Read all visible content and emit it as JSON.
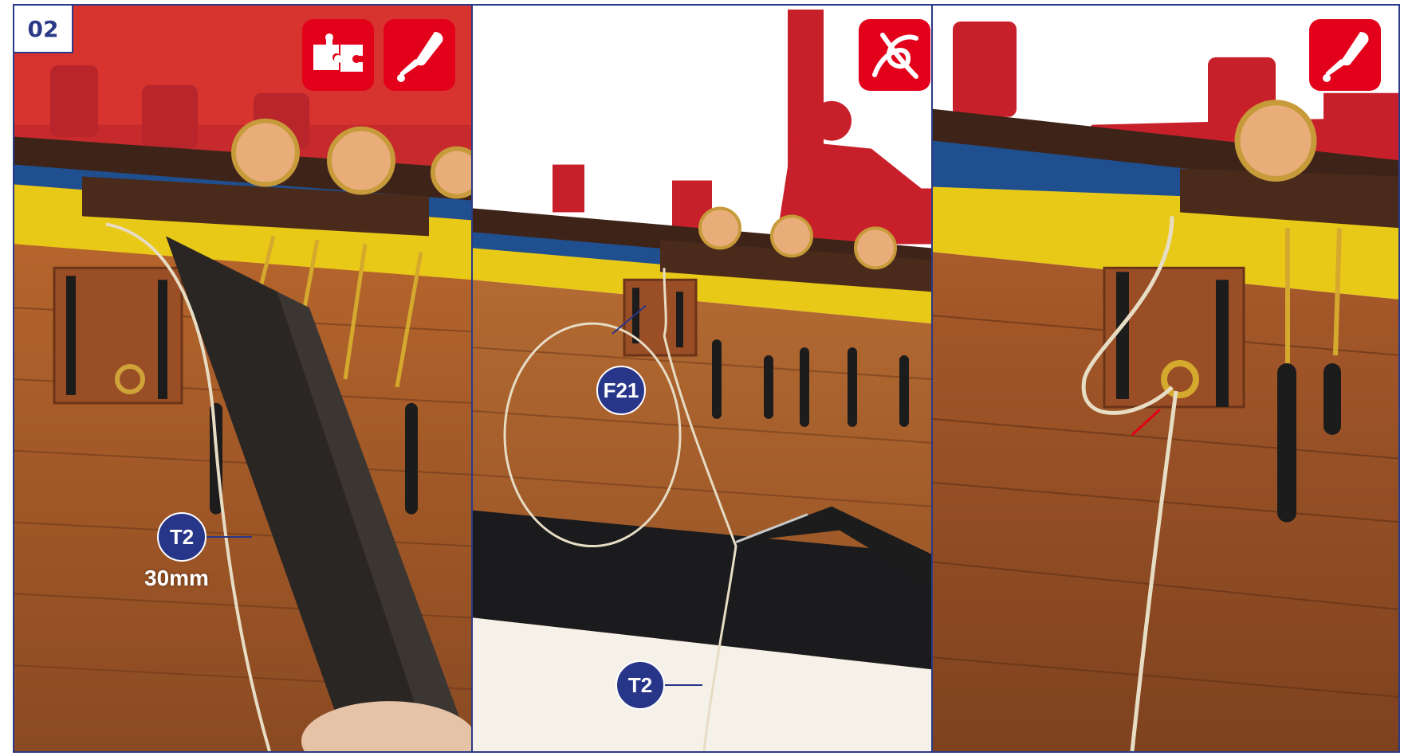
{
  "step": {
    "number": "02"
  },
  "panels": [
    {
      "icons": [
        "puzzle-assembly-icon",
        "glue-bottle-icon"
      ],
      "labels": [
        {
          "code": "T2",
          "measure": "30mm"
        }
      ]
    },
    {
      "icons": [
        "rope-knot-icon"
      ],
      "labels": [
        {
          "code": "F21"
        },
        {
          "code": "T2"
        }
      ]
    },
    {
      "icons": [
        "glue-bottle-icon"
      ],
      "labels": []
    }
  ],
  "colors": {
    "frame": "#2b3a87",
    "badge": "#28368a",
    "icon_bg": "#e2001a",
    "hull_wood": "#a0582a",
    "gunwale_red": "#c8202a",
    "yellow_stripe": "#f0d21a",
    "blue_stripe": "#1f4f8f"
  }
}
